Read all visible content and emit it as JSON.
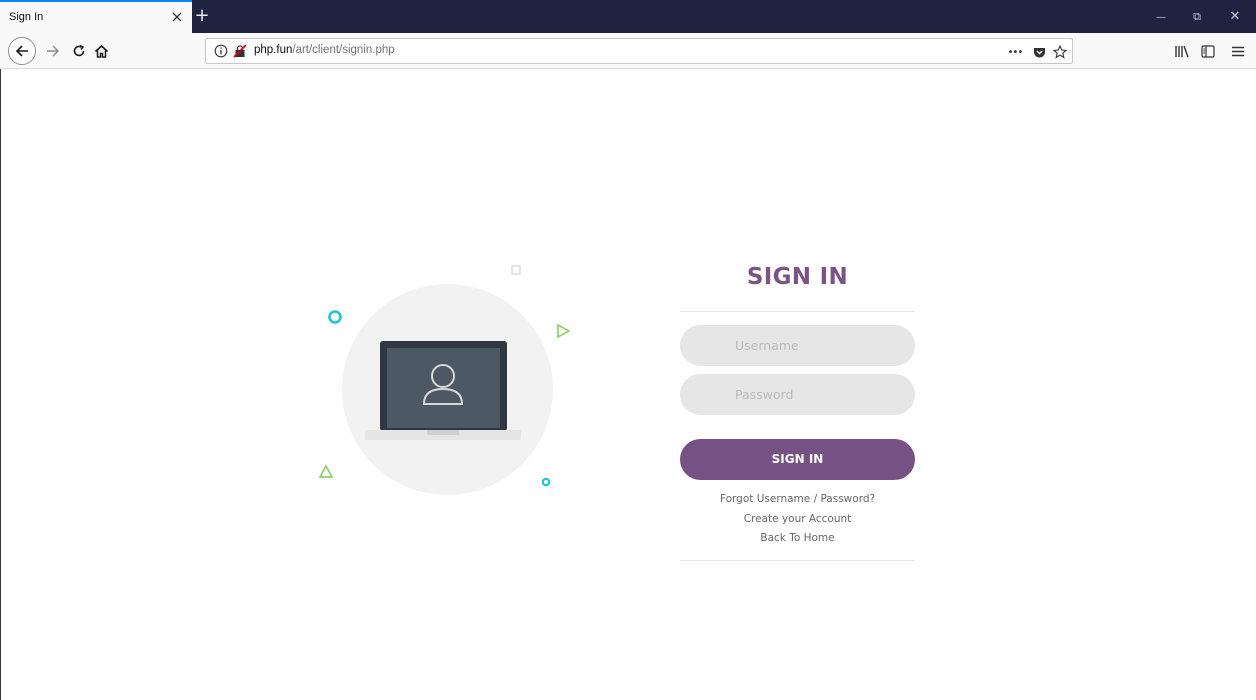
{
  "browser": {
    "tab_title": "Sign In",
    "new_tab_symbol": "+",
    "url_host": "php.fun",
    "url_path": "/art/client/signin.php",
    "page_actions_symbol": "•••",
    "window": {
      "minimize": "—",
      "restore": "⧉",
      "close": "✕"
    }
  },
  "page": {
    "title": "SIGN IN",
    "username_placeholder": "Username",
    "password_placeholder": "Password",
    "signin_button": "SIGN IN",
    "links": {
      "forgot": "Forgot Username / Password?",
      "create": "Create your Account",
      "home": "Back To Home"
    }
  },
  "colors": {
    "accent": "#765284",
    "title": "#7a5387",
    "field_bg": "#e6e6e6",
    "circle_bg": "#f2f2f2",
    "cyan": "#1fc3dd",
    "green": "#8ed06a",
    "titlebar": "#202340"
  },
  "icons": [
    "close-icon",
    "plus-icon",
    "back-arrow-icon",
    "forward-arrow-icon",
    "reload-icon",
    "home-icon",
    "info-icon",
    "insecure-lock-icon",
    "pocket-icon",
    "star-icon",
    "library-icon",
    "sidebar-icon",
    "menu-icon",
    "laptop-icon",
    "user-icon"
  ]
}
